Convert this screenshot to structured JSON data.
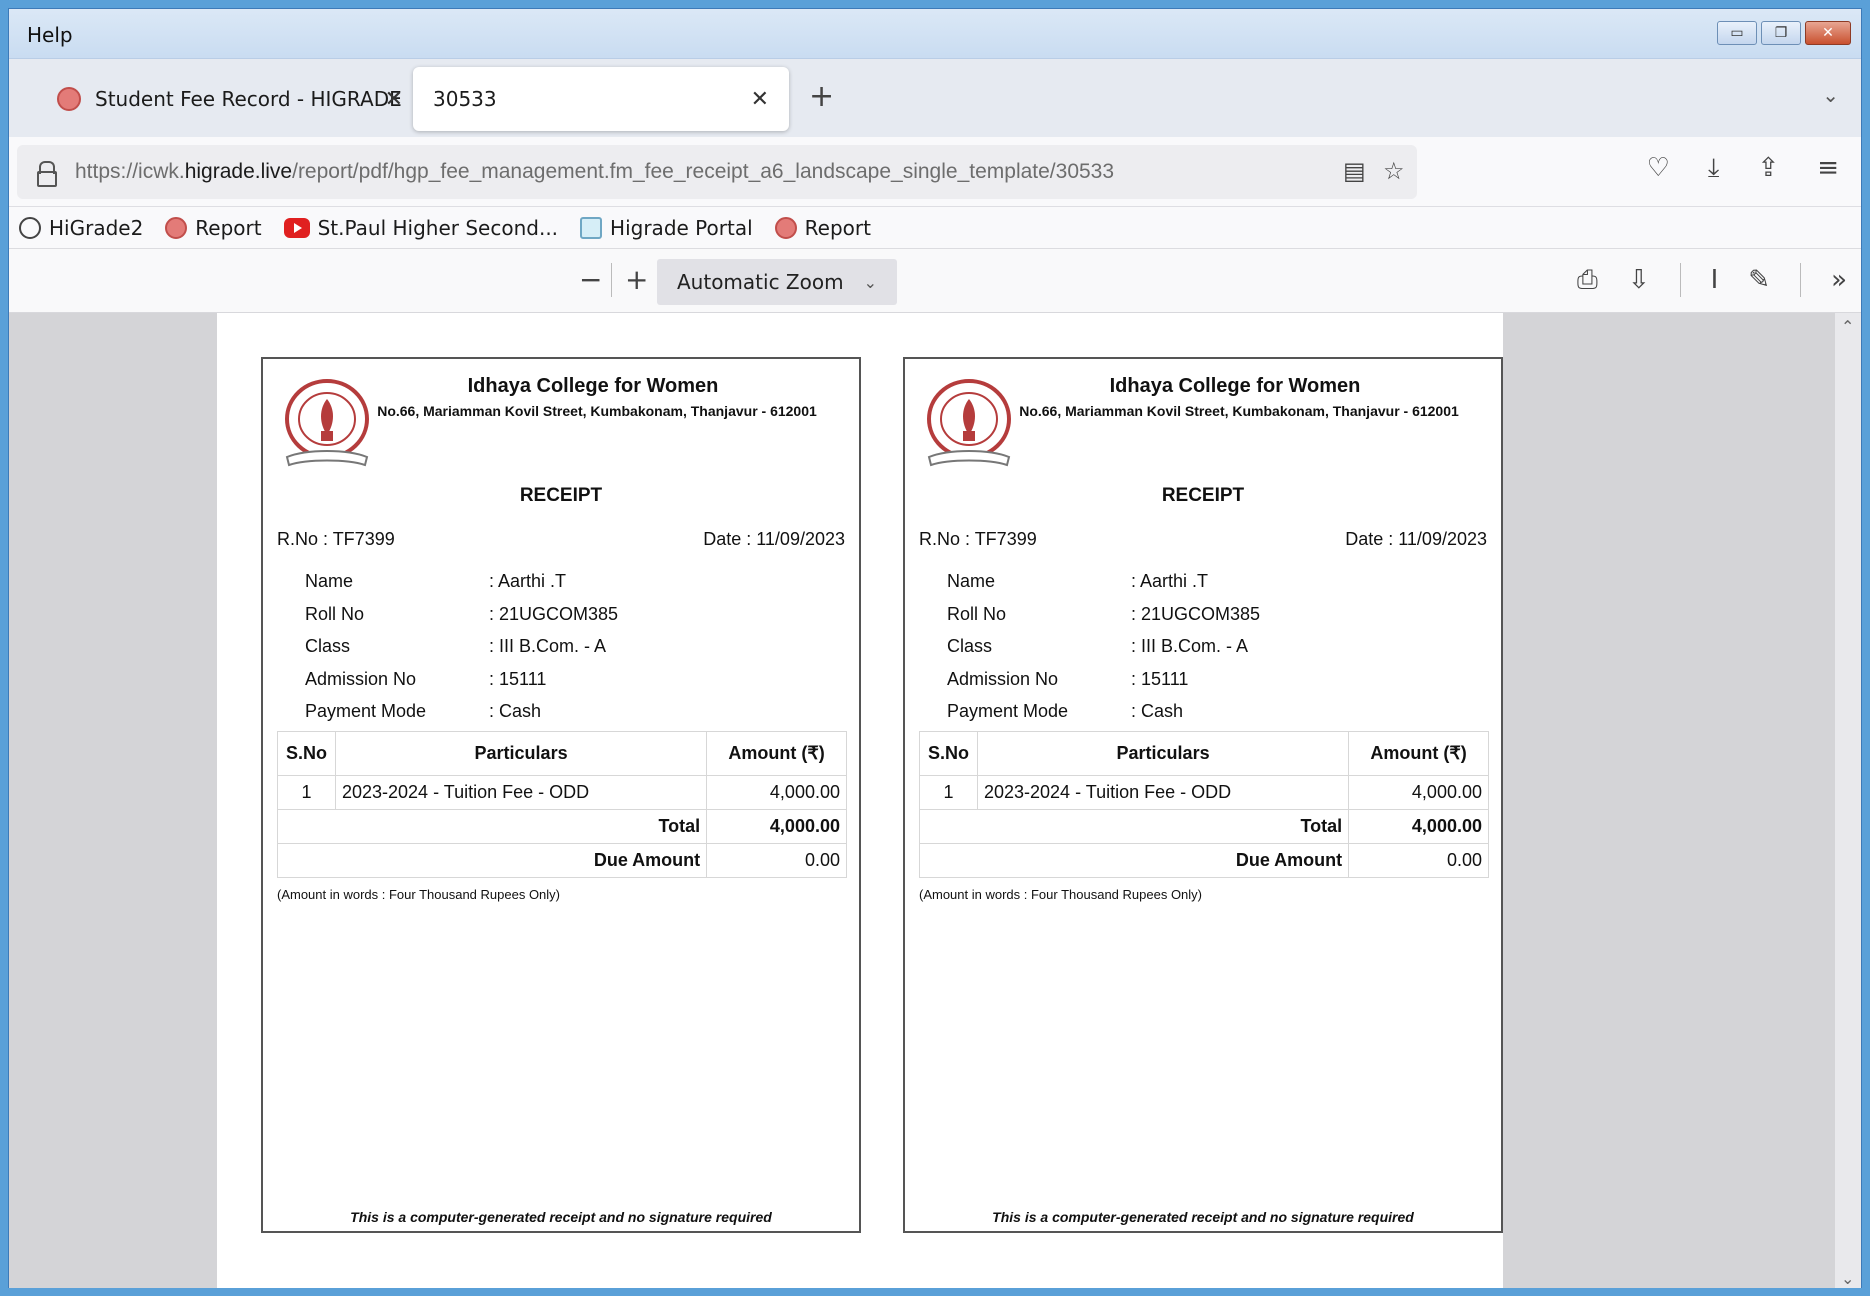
{
  "menu": {
    "help": "Help"
  },
  "tabs": [
    {
      "label": "Student Fee Record - HIGRADE"
    },
    {
      "label": "30533"
    }
  ],
  "url": {
    "prefix": "https://icwk.",
    "domain": "higrade.live",
    "path": "/report/pdf/hgp_fee_management.fm_fee_receipt_a6_landscape_single_template/30533"
  },
  "bookmarks": [
    {
      "label": "HiGrade2",
      "icon": "globe-icon"
    },
    {
      "label": "Report",
      "icon": "higrade-icon"
    },
    {
      "label": "St.Paul Higher Second...",
      "icon": "youtube-icon"
    },
    {
      "label": "Higrade Portal",
      "icon": "portal-icon"
    },
    {
      "label": "Report",
      "icon": "higrade-icon"
    }
  ],
  "pdf_toolbar": {
    "zoom": "Automatic Zoom"
  },
  "receipt": {
    "college_name": "Idhaya College for Women",
    "address": "No.66, Mariamman Kovil Street, Kumbakonam, Thanjavur - 612001",
    "title": "RECEIPT",
    "rno": "R.No : TF7399",
    "date": "Date : 11/09/2023",
    "fields": [
      {
        "label": "Name",
        "value": ": Aarthi .T"
      },
      {
        "label": "Roll No",
        "value": ": 21UGCOM385"
      },
      {
        "label": "Class",
        "value": ": III B.Com. - A"
      },
      {
        "label": "Admission No",
        "value": ": 15111"
      },
      {
        "label": "Payment Mode",
        "value": ": Cash"
      }
    ],
    "table": {
      "headers": [
        "S.No",
        "Particulars",
        "Amount (₹)"
      ],
      "rows": [
        {
          "sno": "1",
          "particular": "2023-2024 - Tuition Fee - ODD",
          "amount": "4,000.00"
        }
      ],
      "total_label": "Total",
      "total_value": "4,000.00",
      "due_label": "Due Amount",
      "due_value": "0.00"
    },
    "words": "(Amount in words : Four Thousand Rupees Only)",
    "footer": "This is a computer-generated receipt and no signature required"
  }
}
